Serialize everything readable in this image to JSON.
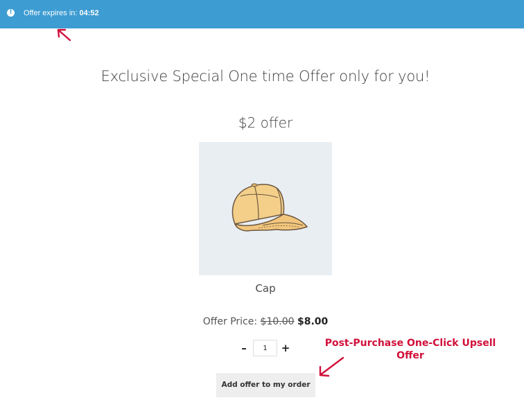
{
  "notice": {
    "icon": "info-icon",
    "label": "Offer expires in:",
    "countdown": "04:52"
  },
  "headline": "Exclusive Special One time Offer only for you!",
  "offer": {
    "title": "$2 offer",
    "product_name": "Cap",
    "image_icon": "cap-illustration",
    "price_label": "Offer Price:",
    "old_price": "$10.00",
    "new_price": "$8.00",
    "quantity": "1",
    "minus_label": "–",
    "plus_label": "+",
    "button_label": "Add offer to my order"
  },
  "annotation": {
    "text": "Post-Purchase One-Click Upsell Offer",
    "color": "#d0103a"
  },
  "colors": {
    "topbar": "#3d9cd2",
    "image_bg": "#e9eef3",
    "button_bg": "#eeeeee"
  }
}
